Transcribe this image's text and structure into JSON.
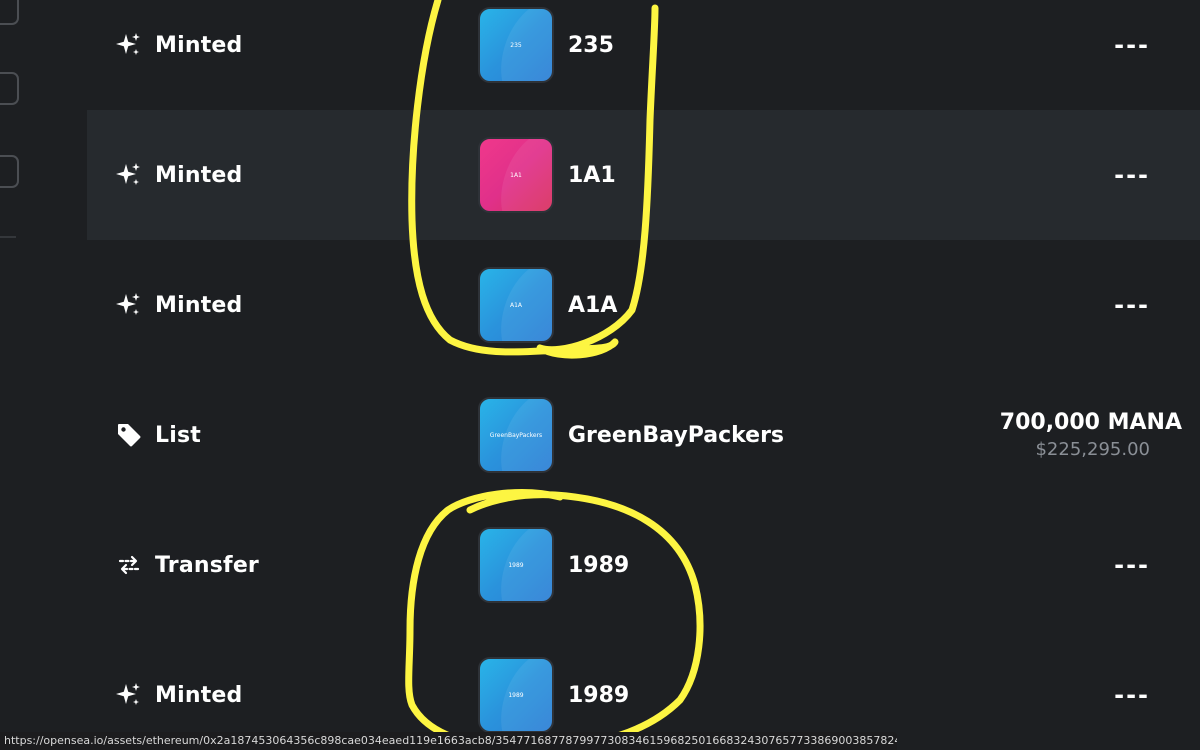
{
  "rows": [
    {
      "event": "Minted",
      "event_icon": "sparkle-icon",
      "item_label": "235",
      "thumb_text": "235",
      "thumb_color": "blue",
      "price": "---"
    },
    {
      "event": "Minted",
      "event_icon": "sparkle-icon",
      "item_label": "1A1",
      "thumb_text": "1A1",
      "thumb_color": "pink",
      "price": "---"
    },
    {
      "event": "Minted",
      "event_icon": "sparkle-icon",
      "item_label": "A1A",
      "thumb_text": "A1A",
      "thumb_color": "blue",
      "price": "---"
    },
    {
      "event": "List",
      "event_icon": "tag-icon",
      "item_label": "GreenBayPackers",
      "thumb_text": "GreenBayPackers",
      "thumb_color": "blue",
      "price": "700,000 MANA",
      "price_usd": "$225,295.00"
    },
    {
      "event": "Transfer",
      "event_icon": "transfer-arrows-icon",
      "item_label": "1989",
      "thumb_text": "1989",
      "thumb_color": "blue",
      "price": "---"
    },
    {
      "event": "Minted",
      "event_icon": "sparkle-icon",
      "item_label": "1989",
      "thumb_text": "1989",
      "thumb_color": "blue",
      "price": "---"
    }
  ],
  "status_bar": {
    "url": "https://opensea.io/assets/ethereum/0x2a187453064356c898cae034eaed119e1663acb8/35477168778799773083461596825016683243076577338690038578248797085172166"
  },
  "colors": {
    "background": "#1d1f22",
    "highlight_row": "#262a2e",
    "thumb_blue": "#2a93dc",
    "thumb_pink": "#e0308a",
    "annotation_yellow": "#fdf542",
    "muted_text": "#8a8f96"
  }
}
